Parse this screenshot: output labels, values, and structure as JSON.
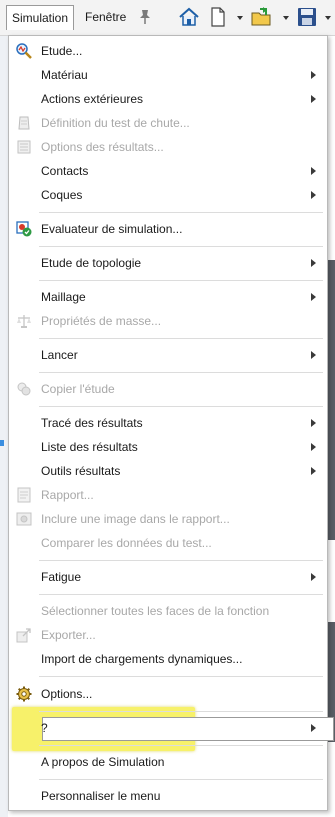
{
  "menubar": {
    "simulation": "Simulation",
    "fenetre": "Fenêtre"
  },
  "toolbar_icons": [
    "pin-icon",
    "home-icon",
    "new-document-icon",
    "open-folder-icon",
    "save-icon"
  ],
  "menu": {
    "etude": "Etude...",
    "materiau": "Matériau",
    "actions": "Actions extérieures",
    "definition_chute": "Définition du test de chute...",
    "options_resultats": "Options des résultats...",
    "contacts": "Contacts",
    "coques": "Coques",
    "evaluateur": "Evaluateur de simulation...",
    "topologie": "Etude de topologie",
    "maillage": "Maillage",
    "proprietes_masse": "Propriétés de masse...",
    "lancer": "Lancer",
    "copier_etude": "Copier l'étude",
    "trace_resultats": "Tracé des résultats",
    "liste_resultats": "Liste des résultats",
    "outils_resultats": "Outils résultats",
    "rapport": "Rapport...",
    "inclure_image": "Inclure une image dans le rapport...",
    "comparer": "Comparer les données du test...",
    "fatigue": "Fatigue",
    "selectionner_faces": "Sélectionner toutes les faces de la fonction",
    "exporter": "Exporter...",
    "import_chargements": "Import de chargements dynamiques...",
    "options": "Options...",
    "aide": "?",
    "a_propos": "A propos de Simulation",
    "personnaliser": "Personnaliser le menu"
  },
  "colors": {
    "highlight": "#f7f16a",
    "disabled_text": "#a8a8a8",
    "accent": "#3a8ee0"
  }
}
